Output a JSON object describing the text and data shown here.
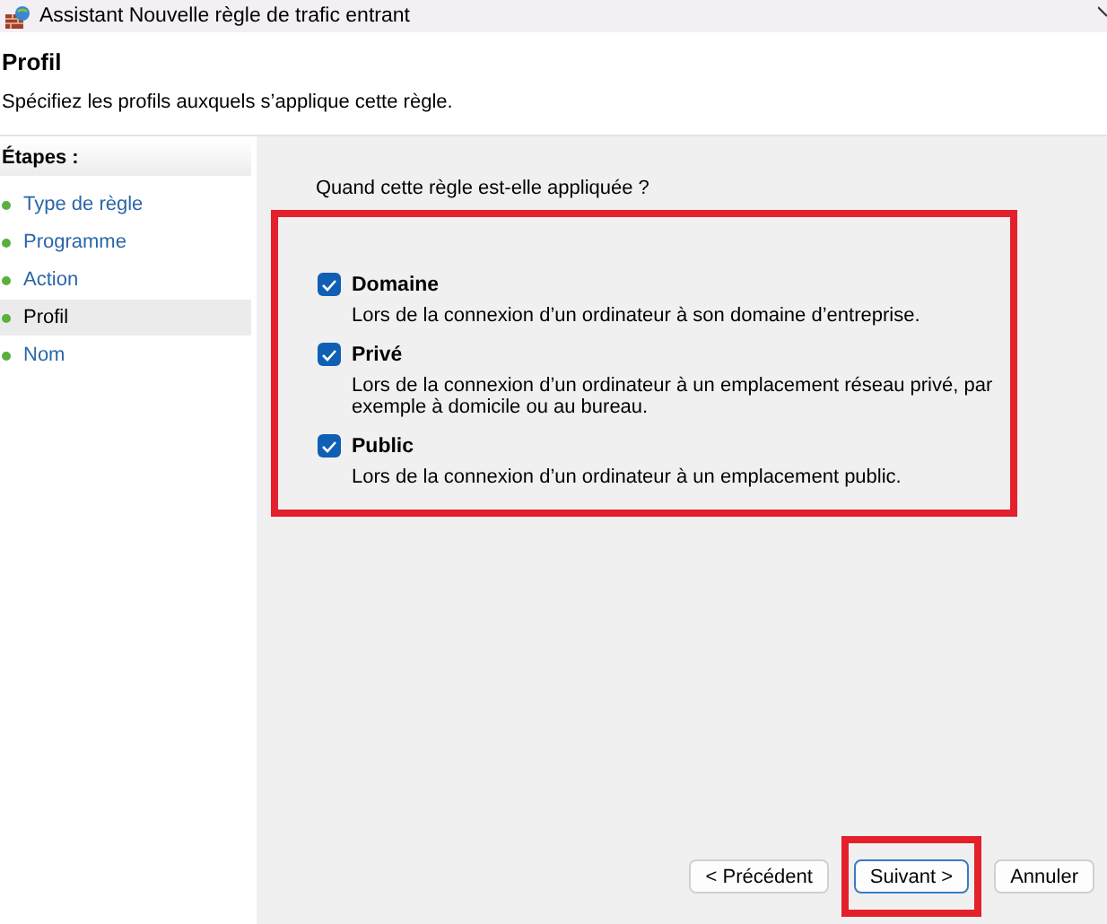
{
  "window": {
    "title": "Assistant Nouvelle règle de trafic entrant"
  },
  "header": {
    "title": "Profil",
    "subtitle": "Spécifiez les profils auxquels s’applique cette règle."
  },
  "steps": {
    "heading": "Étapes :",
    "items": [
      {
        "label": "Type de règle",
        "selected": false
      },
      {
        "label": "Programme",
        "selected": false
      },
      {
        "label": "Action",
        "selected": false
      },
      {
        "label": "Profil",
        "selected": true
      },
      {
        "label": "Nom",
        "selected": false
      }
    ]
  },
  "question": "Quand cette règle est-elle appliquée ?",
  "profiles": {
    "highlighted": true,
    "options": [
      {
        "label": "Domaine",
        "checked": true,
        "description": "Lors de la connexion d’un ordinateur à son domaine d’entreprise."
      },
      {
        "label": "Privé",
        "checked": true,
        "description": "Lors de la connexion d’un ordinateur à un emplacement réseau privé, par exemple à domicile ou au bureau."
      },
      {
        "label": "Public",
        "checked": true,
        "description": "Lors de la connexion d’un ordinateur à un emplacement public."
      }
    ]
  },
  "buttons": [
    {
      "label": "< Précédent",
      "highlighted": false,
      "default": false
    },
    {
      "label": "Suivant >",
      "highlighted": true,
      "default": true
    },
    {
      "label": "Annuler",
      "highlighted": false,
      "default": false
    }
  ]
}
